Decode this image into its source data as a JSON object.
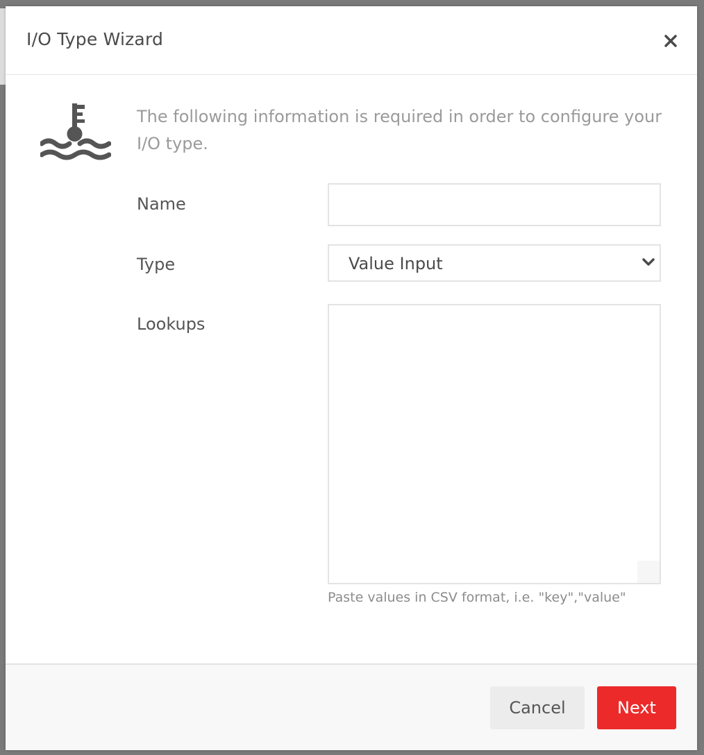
{
  "dialog": {
    "title": "I/O Type Wizard",
    "close_icon": "close-icon",
    "intro_text": "The following information is required in order to configure your I/O type.",
    "icon": "water-level-key-icon"
  },
  "form": {
    "name_label": "Name",
    "name_value": "",
    "type_label": "Type",
    "type_value": "Value Input",
    "lookups_label": "Lookups",
    "lookups_value": "",
    "lookups_helper": "Paste values in CSV format, i.e. \"key\",\"value\""
  },
  "footer": {
    "cancel_label": "Cancel",
    "next_label": "Next"
  },
  "colors": {
    "accent": "#ec2a2a",
    "title_text": "#4a4a4a",
    "muted_text": "#9a9a9a",
    "border": "#e3e3e3",
    "icon": "#555555"
  }
}
